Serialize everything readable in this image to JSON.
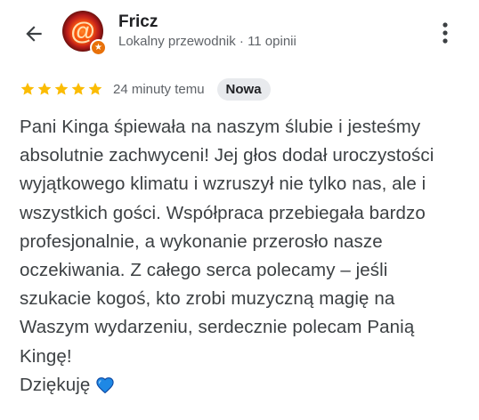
{
  "header": {
    "back_icon": "arrow-left-icon",
    "avatar_icon": "at-sign-avatar",
    "badge_icon": "local-guide-star-icon",
    "name": "Fricz",
    "subtitle": "Lokalny przewodnik · 11 opinii",
    "more_icon": "more-vert-icon"
  },
  "review": {
    "rating": 5,
    "rating_max": 5,
    "star_color": "#fbbc04",
    "time": "24 minuty temu",
    "badge": "Nowa",
    "lines": [
      "Pani Kinga śpiewała na naszym ślubie i jesteśmy",
      "absolutnie zachwyceni! Jej głos dodał uroczystości",
      "wyjątkowego klimatu i wzruszył nie tylko nas, ale i",
      "wszystkich gości. Współpraca przebiegała bardzo",
      "profesjonalnie, a wykonanie przerosło nasze",
      "oczekiwania. Z całego serca polecamy – jeśli",
      "szukacie kogoś, kto zrobi muzyczną magię na",
      "Waszym wydarzeniu, serdecznie polecam Panią",
      "Kingę!",
      "Dziękuję"
    ],
    "emoji_icon": "blue-heart-icon",
    "heart_color": "#1e88e5"
  }
}
